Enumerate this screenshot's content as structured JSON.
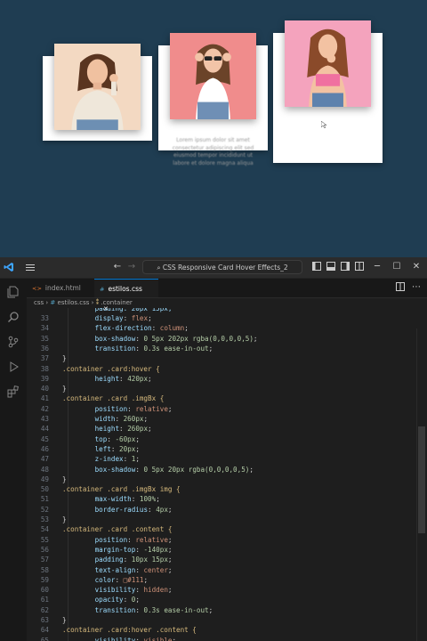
{
  "preview": {
    "card_text_lines": [
      "Lorem ipsum dolor sit amet",
      "consectetur adipiscing elit sed",
      "eiusmod tempor incididunt ut",
      "labore et dolore magna aliqua"
    ]
  },
  "vscode": {
    "title": "CSS Responsive Card Hover Effects_2",
    "tabs": [
      {
        "icon": "<>",
        "label": "index.html"
      },
      {
        "icon": "#",
        "label": "estilos.css",
        "close": "✕"
      }
    ],
    "breadcrumb": [
      "css",
      "estilos.css",
      ".container"
    ],
    "partial_top_line": "padding: 20px 15px;",
    "code_lines": [
      {
        "n": "33",
        "indent": 2,
        "prop": "display",
        "val": "flex"
      },
      {
        "n": "34",
        "indent": 2,
        "prop": "flex-direction",
        "val": "column"
      },
      {
        "n": "35",
        "indent": 2,
        "prop": "box-shadow",
        "val": "0 5px 202px rgba(0,0,0,0,5)"
      },
      {
        "n": "36",
        "indent": 2,
        "prop": "transition",
        "val": "0.3s ease-in-out"
      },
      {
        "n": "37",
        "indent": 1,
        "raw": "}"
      },
      {
        "n": "38",
        "indent": 1,
        "sel": ".container .card:hover {"
      },
      {
        "n": "39",
        "indent": 2,
        "prop": "height",
        "val": "420px"
      },
      {
        "n": "40",
        "indent": 1,
        "raw": "}"
      },
      {
        "n": "41",
        "indent": 1,
        "sel": ".container .card .imgBx {"
      },
      {
        "n": "42",
        "indent": 2,
        "prop": "position",
        "val": "relative"
      },
      {
        "n": "43",
        "indent": 2,
        "prop": "width",
        "val": "260px"
      },
      {
        "n": "44",
        "indent": 2,
        "prop": "height",
        "val": "260px"
      },
      {
        "n": "45",
        "indent": 2,
        "prop": "top",
        "val": "-60px"
      },
      {
        "n": "46",
        "indent": 2,
        "prop": "left",
        "val": "20px"
      },
      {
        "n": "47",
        "indent": 2,
        "prop": "z-index",
        "val": "1"
      },
      {
        "n": "48",
        "indent": 2,
        "prop": "box-shadow",
        "val": "0 5px 20px rgba(0,0,0,0,5)"
      },
      {
        "n": "49",
        "indent": 1,
        "raw": "}"
      },
      {
        "n": "50",
        "indent": 1,
        "sel": ".container .card .imgBx img {"
      },
      {
        "n": "51",
        "indent": 2,
        "prop": "max-width",
        "val": "100%"
      },
      {
        "n": "52",
        "indent": 2,
        "prop": "border-radius",
        "val": "4px"
      },
      {
        "n": "53",
        "indent": 1,
        "raw": "}"
      },
      {
        "n": "54",
        "indent": 1,
        "sel": ".container .card .content {"
      },
      {
        "n": "55",
        "indent": 2,
        "prop": "position",
        "val": "relative"
      },
      {
        "n": "56",
        "indent": 2,
        "prop": "margin-top",
        "val": "-140px"
      },
      {
        "n": "57",
        "indent": 2,
        "prop": "padding",
        "val": "10px 15px"
      },
      {
        "n": "58",
        "indent": 2,
        "prop": "text-align",
        "val": "center"
      },
      {
        "n": "59",
        "indent": 2,
        "prop": "color",
        "val": "□#111"
      },
      {
        "n": "60",
        "indent": 2,
        "prop": "visibility",
        "val": "hidden"
      },
      {
        "n": "61",
        "indent": 2,
        "prop": "opacity",
        "val": "0"
      },
      {
        "n": "62",
        "indent": 2,
        "prop": "transition",
        "val": "0.3s ease-in-out"
      },
      {
        "n": "63",
        "indent": 1,
        "raw": "}"
      },
      {
        "n": "64",
        "indent": 1,
        "sel": ".container .card:hover .content {"
      },
      {
        "n": "65",
        "indent": 2,
        "prop": "visibility",
        "val": "visible"
      }
    ]
  },
  "colors": {
    "preview_bg": "#1f3d52",
    "card_bg": "#ffffff",
    "photo1_bg": "#f3d9c2",
    "photo2_bg": "#f08c8c",
    "photo3_bg": "#f4a3bd",
    "editor_bg": "#1e1e1e",
    "accent": "#0078d4"
  }
}
